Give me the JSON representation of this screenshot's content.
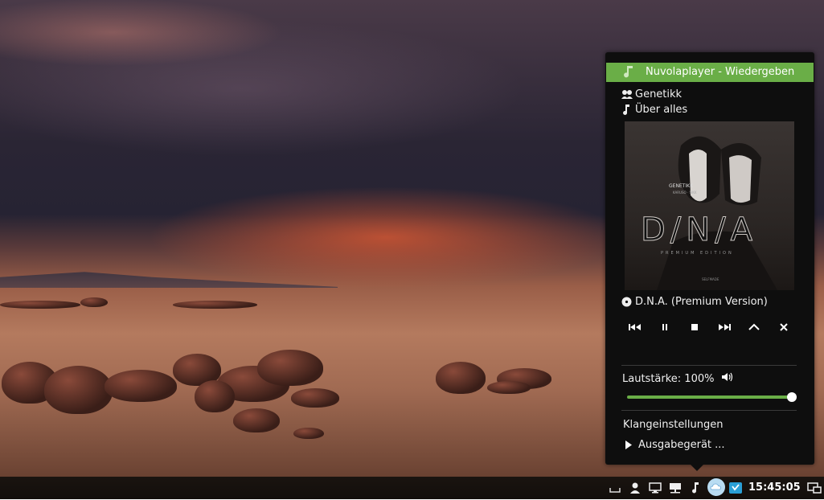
{
  "popup": {
    "title": "Nuvolaplayer - Wiedergeben",
    "artist": "Genetikk",
    "track": "Über alles",
    "album": "D.N.A. (Premium Version)",
    "volume_label": "Lautstärke: 100%",
    "volume_level": 1.0,
    "sound_settings": "Klangeinstellungen",
    "output_device": "Ausgabegerät ...",
    "cover": {
      "band": "GENETIKK",
      "subtitle": "KARUSO · SIKK",
      "title": "D/N/A",
      "edition": "PREMIUM EDITION",
      "label": "SELFMADE"
    },
    "controls": [
      "previous",
      "pause",
      "stop",
      "next",
      "raise",
      "close"
    ]
  },
  "taskbar": {
    "clock": "15:45:05",
    "icons": [
      "keyboard-icon",
      "user-icon",
      "display-icon",
      "network-icon",
      "music-icon",
      "cloud-icon",
      "update-icon",
      "windows-icon"
    ]
  },
  "colors": {
    "accent": "#6aae47",
    "panel": "#0e0e0e"
  }
}
